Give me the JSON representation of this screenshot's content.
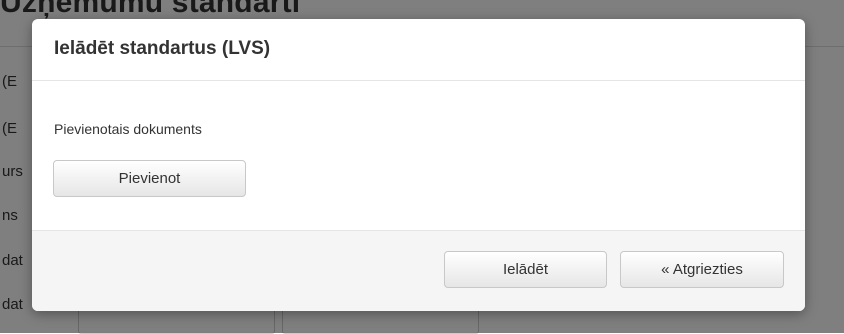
{
  "background": {
    "title": "Uzņēmumu standarti",
    "row_labels": [
      "(E",
      "(E",
      "urs",
      "ns",
      "dat",
      "dat"
    ]
  },
  "modal": {
    "title": "Ielādēt standartus (LVS)",
    "document_label": "Pievienotais dokuments",
    "add_button": "Pievienot",
    "load_button": "Ielādēt",
    "back_button": "« Atgriezties"
  }
}
